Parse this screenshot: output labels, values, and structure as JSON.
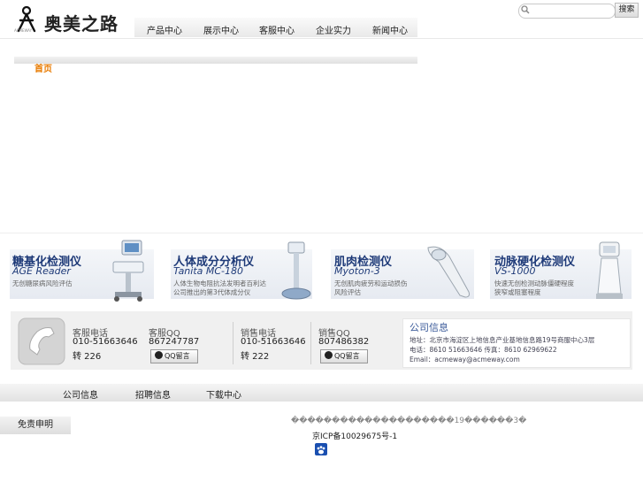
{
  "header": {
    "logo_text": "奥美之路",
    "logo_sub": "ACMEWAY"
  },
  "nav": [
    {
      "label": "产品中心"
    },
    {
      "label": "展示中心"
    },
    {
      "label": "客服中心"
    },
    {
      "label": "企业实力"
    },
    {
      "label": "新闻中心"
    }
  ],
  "search": {
    "placeholder": "",
    "button": "搜索"
  },
  "breadcrumb": {
    "home": "首页"
  },
  "products": [
    {
      "title": "糖基化检测仪",
      "model": "AGE Reader",
      "desc": [
        "无创糖尿病风险评估"
      ]
    },
    {
      "title": "人体成分分析仪",
      "model": "Tanita MC-180",
      "desc": [
        "人体生物电阻抗法发明者百利达",
        "公司推出的第3代体成分仪"
      ]
    },
    {
      "title": "肌肉检测仪",
      "model": "Myoton-3",
      "desc": [
        "无创肌肉疲劳和运动损伤",
        "风险评估"
      ]
    },
    {
      "title": "动脉硬化检测仪",
      "model": "VS-1000",
      "desc": [
        "快速无创检测动脉僵硬程度",
        "狭窄或阻塞程度"
      ]
    }
  ],
  "contact": {
    "service_phone_label": "客服电话",
    "service_phone": "010-51663646",
    "service_ext": "转 226",
    "service_qq_label": "客服QQ",
    "service_qq": "867247787",
    "qq_button": "QQ留言",
    "sales_phone_label": "销售电话",
    "sales_phone": "010-51663646",
    "sales_ext": "转 222",
    "sales_qq_label": "销售QQ",
    "sales_qq": "807486382",
    "info_title": "公司信息",
    "address": "地址：北京市海淀区上地信息产业基地信息路19号商服中心3层",
    "tel": "电话：8610 51663646  传真：8610 62969622",
    "email": "Email：acmeway@acmeway.com"
  },
  "footer_nav": [
    {
      "label": "公司信息"
    },
    {
      "label": "招聘信息"
    },
    {
      "label": "下载中心"
    }
  ],
  "footer": {
    "disclaimer": "免责申明",
    "copyright": "��������������������19������3�",
    "icp": "京ICP备10029675号-1"
  },
  "colors": {
    "accent": "#e87a00",
    "brand": "#1e3a78"
  }
}
